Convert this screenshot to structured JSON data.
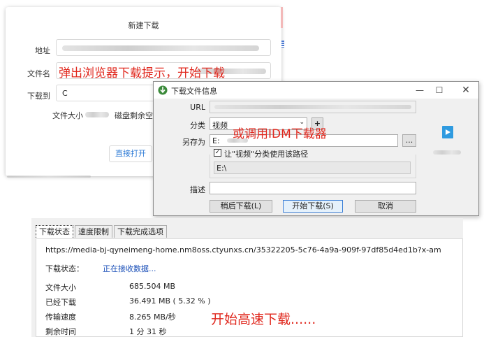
{
  "browser_dialog": {
    "title": "新建下载",
    "address_label": "地址",
    "filename_label": "文件名",
    "save_to_label": "下载到",
    "save_to_value": "C",
    "filesize_label": "文件大小",
    "disk_free_label": "磁盘剩余空间",
    "open_button": "直接打开"
  },
  "annotations": {
    "browser_tip": "弹出浏览器下载提示，开始下载",
    "idm_tip": "或调用IDM下载器",
    "fast_tip": "开始高速下载......"
  },
  "idm_dialog": {
    "title": "下载文件信息",
    "url_label": "URL",
    "category_label": "分类",
    "category_value": "视频",
    "add_category_button": "+",
    "save_as_label": "另存为",
    "save_as_value": "E:",
    "browse_button": "...",
    "use_path_checkbox": "让\"视频\"分类使用该路径",
    "use_path_checked": true,
    "path_value": "E:\\",
    "description_label": "描述",
    "description_value": "",
    "later_button": "稍后下载(L)",
    "start_button": "开始下载(S)",
    "cancel_button": "取消",
    "minimize_icon": "minimize-icon",
    "maximize_icon": "maximize-icon",
    "close_icon": "close-icon"
  },
  "progress_panel": {
    "tabs": [
      "下载状态",
      "速度限制",
      "下载完成选项"
    ],
    "url": "https://media-bj-qyneimeng-home.nm8oss.ctyunxs.cn/35322205-5c76-4a9a-909f-97df85d4ed1b?x-am",
    "status_label": "下载状态：",
    "status_value": "正在接收数据...",
    "rows": [
      {
        "label": "文件大小",
        "value": "685.504  MB"
      },
      {
        "label": "已经下载",
        "value": "36.491  MB  ( 5.32 % )"
      },
      {
        "label": "传输速度",
        "value": "8.265  MB/秒"
      },
      {
        "label": "剩余时间",
        "value": "1 分 31 秒"
      }
    ]
  },
  "colors": {
    "annotation_red": "#e0281e",
    "link_blue": "#2e7bd6",
    "status_blue": "#1a4fb8"
  }
}
